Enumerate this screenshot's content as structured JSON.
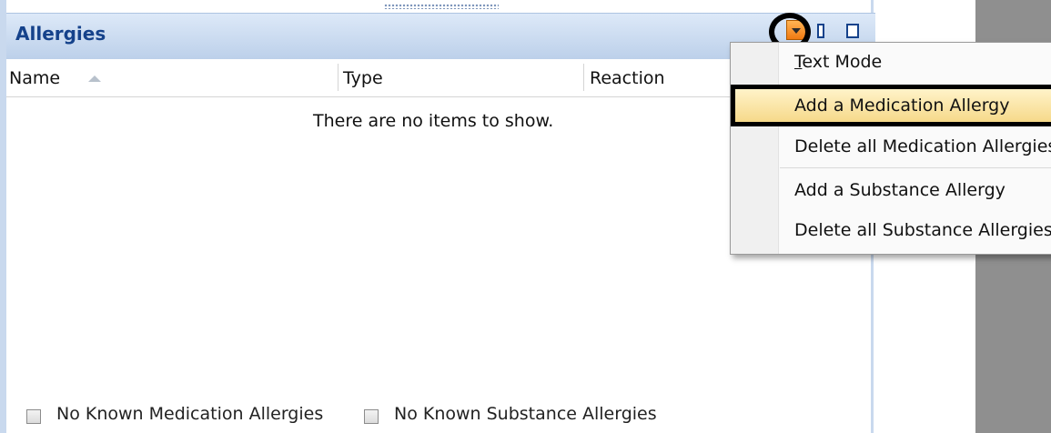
{
  "panel": {
    "title": "Allergies"
  },
  "columns": {
    "name": "Name",
    "type": "Type",
    "reaction": "Reaction"
  },
  "empty_message": "There are no items to show.",
  "footer": {
    "medication": "No Known Medication Allergies",
    "substance": "No Known Substance Allergies"
  },
  "menu": {
    "text_mode_first": "T",
    "text_mode_rest": "ext Mode",
    "add_medication": "Add a Medication Allergy",
    "delete_medication": "Delete all Medication Allergies",
    "add_substance": "Add a Substance Allergy",
    "delete_substance": "Delete all Substance Allergies"
  },
  "icons": {
    "dropdown": "chevron-down-icon",
    "pin": "pin-icon",
    "maximize": "maximize-icon",
    "sort": "sort-ascending-icon"
  },
  "colors": {
    "title": "#15428b",
    "header_top": "#dde9f8",
    "header_bottom": "#bcd0ea",
    "highlight": "#f6d98a",
    "dropdown_button": "#f07a12"
  }
}
